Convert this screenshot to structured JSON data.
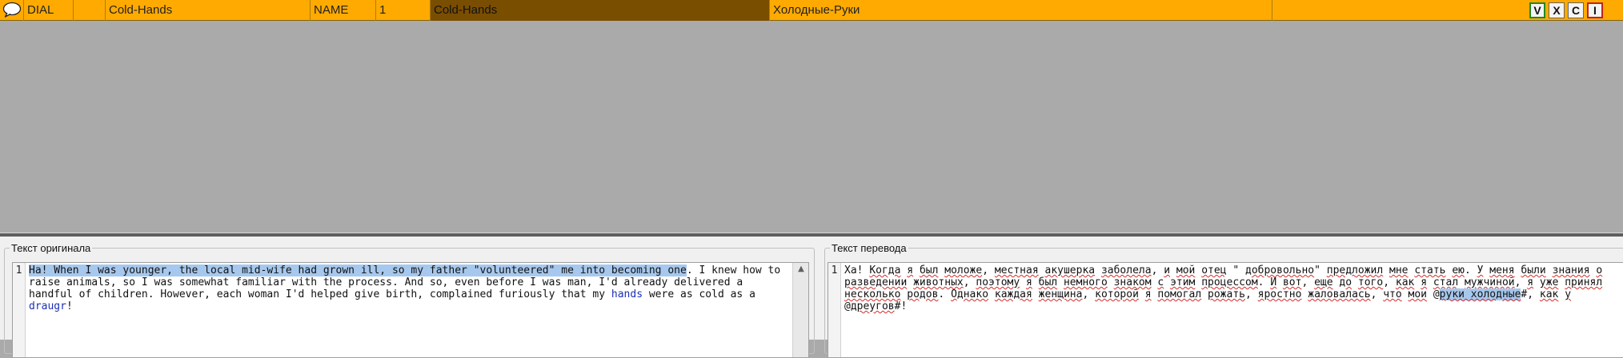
{
  "row": {
    "type": "DIAL",
    "empty": "",
    "id_text": "Cold-Hands",
    "field": "NAME",
    "index": "1",
    "original": "Cold-Hands",
    "translation": "Холодные-Руки",
    "extra": ""
  },
  "buttons": {
    "v": "V",
    "x": "X",
    "c": "C",
    "i": "I"
  },
  "original_panel": {
    "legend": "Текст оригинала",
    "line_number": "1",
    "segments": [
      {
        "t": "Ha! When I was younger, the local mid-wife had grown ill, so my father \"volunteered\" me into becoming one",
        "c": "sel"
      },
      {
        "t": ". I knew how to raise animals, so I was somewhat familiar with the process. And so, even before I was man, I'd already delivered a handful of children. However, each woman I'd helped give birth, complained furiously that my ",
        "c": ""
      },
      {
        "t": "hands",
        "c": "kw"
      },
      {
        "t": " were as cold as a ",
        "c": ""
      },
      {
        "t": "draugr",
        "c": "kw"
      },
      {
        "t": "!",
        "c": ""
      }
    ]
  },
  "translation_panel": {
    "legend": "Текст перевода",
    "line_number": "1",
    "segments": [
      {
        "t": "Ха! ",
        "c": ""
      },
      {
        "t": "Когда",
        "c": "err"
      },
      {
        "t": " ",
        "c": ""
      },
      {
        "t": "я",
        "c": "err"
      },
      {
        "t": " ",
        "c": ""
      },
      {
        "t": "был",
        "c": "err"
      },
      {
        "t": " ",
        "c": ""
      },
      {
        "t": "моложе",
        "c": "err"
      },
      {
        "t": ", ",
        "c": ""
      },
      {
        "t": "местная",
        "c": "err"
      },
      {
        "t": " ",
        "c": ""
      },
      {
        "t": "акушерка",
        "c": "err"
      },
      {
        "t": " ",
        "c": ""
      },
      {
        "t": "заболела",
        "c": "err"
      },
      {
        "t": ", ",
        "c": ""
      },
      {
        "t": "и",
        "c": "err"
      },
      {
        "t": " ",
        "c": ""
      },
      {
        "t": "мой",
        "c": "err"
      },
      {
        "t": " ",
        "c": ""
      },
      {
        "t": "отец",
        "c": "err"
      },
      {
        "t": " \" ",
        "c": ""
      },
      {
        "t": "добровольно",
        "c": "err"
      },
      {
        "t": "\" ",
        "c": ""
      },
      {
        "t": "предложил",
        "c": "err"
      },
      {
        "t": " ",
        "c": ""
      },
      {
        "t": "мне",
        "c": "err"
      },
      {
        "t": " ",
        "c": ""
      },
      {
        "t": "стать",
        "c": "err"
      },
      {
        "t": " ",
        "c": ""
      },
      {
        "t": "ею",
        "c": "err"
      },
      {
        "t": ". ",
        "c": ""
      },
      {
        "t": "У",
        "c": "err"
      },
      {
        "t": " ",
        "c": ""
      },
      {
        "t": "меня",
        "c": "err"
      },
      {
        "t": " ",
        "c": ""
      },
      {
        "t": "были",
        "c": "err"
      },
      {
        "t": " ",
        "c": ""
      },
      {
        "t": "знания",
        "c": "err"
      },
      {
        "t": " ",
        "c": ""
      },
      {
        "t": "о",
        "c": "err"
      },
      {
        "t": " ",
        "c": ""
      },
      {
        "t": "разведении",
        "c": "err"
      },
      {
        "t": " ",
        "c": ""
      },
      {
        "t": "животных",
        "c": "err"
      },
      {
        "t": ", ",
        "c": ""
      },
      {
        "t": "поэтому",
        "c": "err"
      },
      {
        "t": " ",
        "c": ""
      },
      {
        "t": "я",
        "c": "err"
      },
      {
        "t": " ",
        "c": ""
      },
      {
        "t": "был",
        "c": "err"
      },
      {
        "t": " ",
        "c": ""
      },
      {
        "t": "немного",
        "c": "err"
      },
      {
        "t": " ",
        "c": ""
      },
      {
        "t": "знаком",
        "c": "err"
      },
      {
        "t": " ",
        "c": ""
      },
      {
        "t": "с",
        "c": "err"
      },
      {
        "t": " ",
        "c": ""
      },
      {
        "t": "этим",
        "c": "err"
      },
      {
        "t": " ",
        "c": ""
      },
      {
        "t": "процессом",
        "c": "err"
      },
      {
        "t": ". ",
        "c": ""
      },
      {
        "t": "И",
        "c": "err"
      },
      {
        "t": " ",
        "c": ""
      },
      {
        "t": "вот",
        "c": "err"
      },
      {
        "t": ", ",
        "c": ""
      },
      {
        "t": "еще",
        "c": "err"
      },
      {
        "t": " ",
        "c": ""
      },
      {
        "t": "до",
        "c": "err"
      },
      {
        "t": " ",
        "c": ""
      },
      {
        "t": "того",
        "c": "err"
      },
      {
        "t": ", ",
        "c": ""
      },
      {
        "t": "как",
        "c": "err"
      },
      {
        "t": " ",
        "c": ""
      },
      {
        "t": "я",
        "c": "err"
      },
      {
        "t": " ",
        "c": ""
      },
      {
        "t": "стал",
        "c": "err"
      },
      {
        "t": " ",
        "c": ""
      },
      {
        "t": "мужчиной",
        "c": "err"
      },
      {
        "t": ", ",
        "c": ""
      },
      {
        "t": "я",
        "c": "err"
      },
      {
        "t": " ",
        "c": ""
      },
      {
        "t": "уже",
        "c": "err"
      },
      {
        "t": " ",
        "c": ""
      },
      {
        "t": "принял",
        "c": "err"
      },
      {
        "t": " ",
        "c": ""
      },
      {
        "t": "несколько",
        "c": "err"
      },
      {
        "t": " ",
        "c": ""
      },
      {
        "t": "родов",
        "c": "err"
      },
      {
        "t": ". ",
        "c": ""
      },
      {
        "t": "Однако",
        "c": "err"
      },
      {
        "t": " ",
        "c": ""
      },
      {
        "t": "каждая",
        "c": "err"
      },
      {
        "t": " ",
        "c": ""
      },
      {
        "t": "женщина",
        "c": "err"
      },
      {
        "t": ", ",
        "c": ""
      },
      {
        "t": "которой",
        "c": "err"
      },
      {
        "t": " ",
        "c": ""
      },
      {
        "t": "я",
        "c": "err"
      },
      {
        "t": " ",
        "c": ""
      },
      {
        "t": "помогал",
        "c": "err"
      },
      {
        "t": " ",
        "c": ""
      },
      {
        "t": "рожать",
        "c": "err"
      },
      {
        "t": ", ",
        "c": ""
      },
      {
        "t": "яростно",
        "c": "err"
      },
      {
        "t": " ",
        "c": ""
      },
      {
        "t": "жаловалась",
        "c": "err"
      },
      {
        "t": ", ",
        "c": ""
      },
      {
        "t": "что",
        "c": "err"
      },
      {
        "t": " ",
        "c": ""
      },
      {
        "t": "мои",
        "c": "err"
      },
      {
        "t": " @",
        "c": ""
      },
      {
        "t": "руки холодные",
        "c": "sel err"
      },
      {
        "t": "#, ",
        "c": ""
      },
      {
        "t": "как",
        "c": "err"
      },
      {
        "t": " ",
        "c": ""
      },
      {
        "t": "у",
        "c": "err"
      },
      {
        "t": " @",
        "c": ""
      },
      {
        "t": "дреугов",
        "c": "err"
      },
      {
        "t": "#!",
        "c": ""
      }
    ]
  },
  "colors": {
    "row_bg": "#ffaa00",
    "row_selected_cell": "#7a4e00",
    "workspace": "#aaaaaa",
    "selection": "#a6c8ee",
    "keyword": "#1c2fb5",
    "spellcheck": "#d42a2a"
  },
  "icons": {
    "row_icon": "speech-bubble-icon",
    "scroll_up": "scroll-up-arrow-icon"
  }
}
